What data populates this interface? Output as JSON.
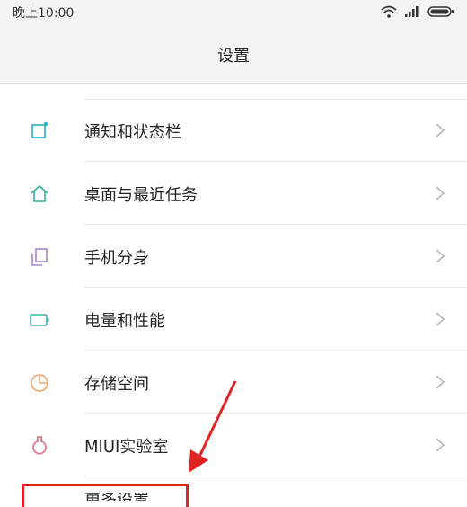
{
  "status_bar": {
    "time": "晚上10:00",
    "icons": [
      "wifi-icon",
      "signal-icon",
      "battery-icon"
    ]
  },
  "header": {
    "title": "设置"
  },
  "settings": {
    "items": [
      {
        "label": "通知和状态栏",
        "icon": "notification-icon",
        "color": "#2ab0c8"
      },
      {
        "label": "桌面与最近任务",
        "icon": "home-icon",
        "color": "#2fb59a"
      },
      {
        "label": "手机分身",
        "icon": "dual-apps-icon",
        "color": "#a487d6"
      },
      {
        "label": "电量和性能",
        "icon": "battery-icon",
        "color": "#36b8a4"
      },
      {
        "label": "存储空间",
        "icon": "storage-icon",
        "color": "#f0a36a"
      },
      {
        "label": "MIUI实验室",
        "icon": "flask-icon",
        "color": "#e56a82"
      }
    ],
    "partial_item": {
      "label": "更多设置"
    }
  },
  "annotation": {
    "highlight_color": "#e02323"
  }
}
